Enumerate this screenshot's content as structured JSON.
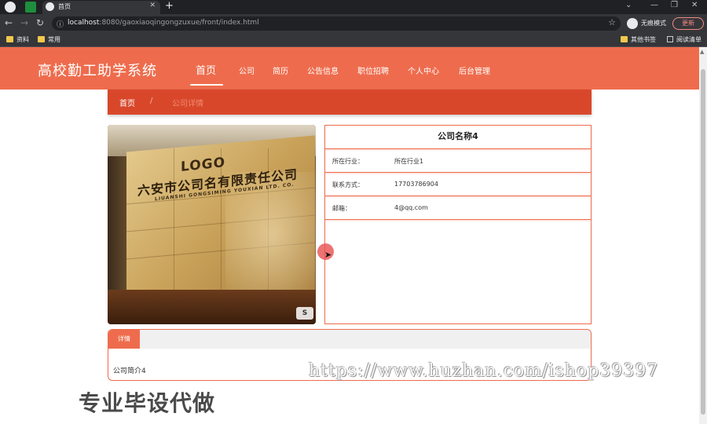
{
  "browser": {
    "tab_title": "首页",
    "url_host": "localhost",
    "url_rest": ":8080/gaoxiaoqingongzuxue/front/index.html",
    "incognito_label": "无痕模式",
    "update_label": "更新",
    "bookmarks": [
      "资料",
      "常用"
    ],
    "bookmarks_right": [
      "其他书签",
      "阅读清单"
    ]
  },
  "site": {
    "title": "高校勤工助学系统",
    "nav": [
      "首页",
      "公司",
      "简历",
      "公告信息",
      "职位招聘",
      "个人中心",
      "后台管理"
    ],
    "active_nav": "首页",
    "accent_color": "#ee6c4d",
    "breadcrumb_color": "#d9472b"
  },
  "breadcrumb": {
    "home": "首页",
    "separator": "/",
    "current": "公司详情"
  },
  "photo": {
    "logo_text": "LOGO",
    "company_text": "六安市公司名有限责任公司",
    "english_text": "LIUANSHI GONGSIMING YOUXIAN LTD. CO."
  },
  "company": {
    "name": "公司名称4",
    "fields": [
      {
        "label": "所在行业：",
        "value": "所在行业1"
      },
      {
        "label": "联系方式：",
        "value": "17703786904"
      },
      {
        "label": "邮箱：",
        "value": "4@qq.com"
      }
    ]
  },
  "details": {
    "tab_label": "详情",
    "text": "公司简介4"
  },
  "overlay": {
    "promo": "专业毕设代做",
    "watermark_url": "https://www.huzhan.com/ishop39397"
  }
}
